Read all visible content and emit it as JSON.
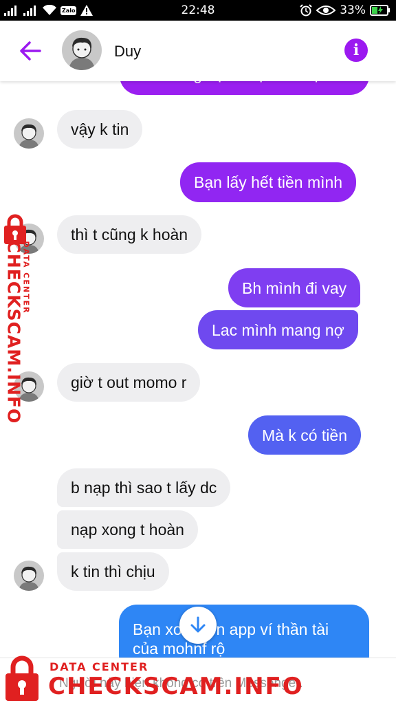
{
  "status_bar": {
    "time": "22:48",
    "battery": "33%",
    "zalo_badge": "Zalo"
  },
  "header": {
    "contact_name": "Duy",
    "info_glyph": "i"
  },
  "messages": [
    {
      "from": "me",
      "text": "tường bạn được nữ bạn"
    },
    {
      "from": "contact",
      "text": "vậy k tin"
    },
    {
      "from": "me",
      "text": "Bạn lấy hết tiền mình"
    },
    {
      "from": "contact",
      "text": "thì t cũng k hoàn"
    },
    {
      "from": "me",
      "text": "Bh mình đi vay"
    },
    {
      "from": "me",
      "text": "Lac mình mang nợ"
    },
    {
      "from": "contact",
      "text": "giờ t out momo r"
    },
    {
      "from": "me",
      "text": "Mà k có tiền"
    },
    {
      "from": "contact",
      "text": "b nạp thì sao t lấy dc"
    },
    {
      "from": "contact",
      "text": "nạp xong t hoàn"
    },
    {
      "from": "contact",
      "text": "k tin thì chịu"
    },
    {
      "from": "me",
      "text_line1": "Bạn xoá luôn app ví thần tài",
      "text_line2": "của mohnf rộ"
    }
  ],
  "footer": {
    "notice": "Người này hiện không có trên Messenger."
  },
  "watermark": {
    "small": "DATA CENTER",
    "big": "CHECKSCAM.INFO"
  },
  "colors": {
    "accent": "#9b19f0",
    "bubble_in": "#eeeef0",
    "watermark": "#e02020"
  },
  "icons": [
    "back-arrow-icon",
    "info-icon",
    "scroll-down-icon",
    "lock-icon",
    "wifi-icon",
    "signal-icon",
    "alarm-icon",
    "eye-icon",
    "battery-icon",
    "warning-icon"
  ]
}
